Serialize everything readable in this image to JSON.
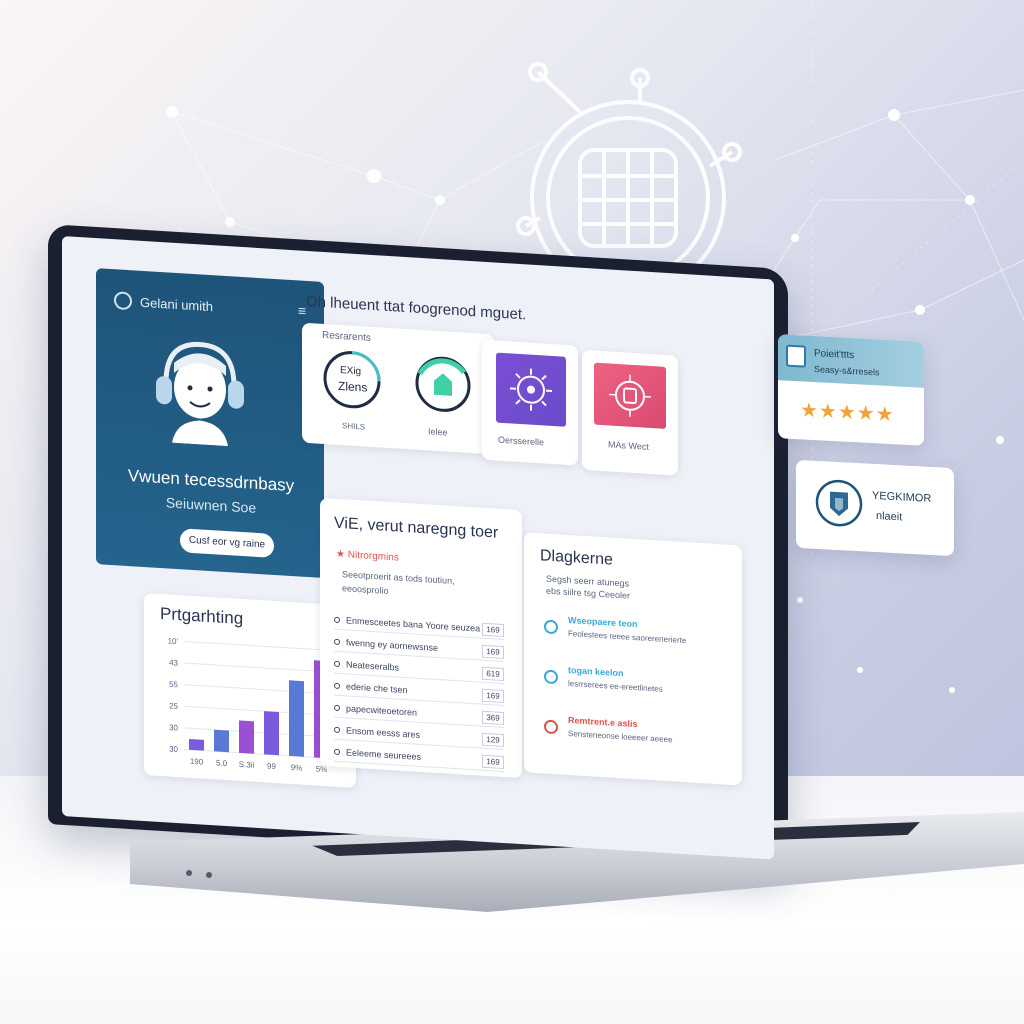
{
  "sidebar": {
    "brand": "Gelani umith",
    "menu_icon": "menu-icon",
    "name": "Vwuen tecessdrnbasy",
    "subtitle": "Seiuwnen Soe",
    "button": "Cusf eor vg raine"
  },
  "header": {
    "title": "Oh lheuent ttat foogrenod mguet."
  },
  "tiles": {
    "label": "Resrarents",
    "gauge1": {
      "value": "Zlens",
      "top": "EXig",
      "caption": "SHILS"
    },
    "gauge2": {
      "caption": "Ielee"
    },
    "tile3": {
      "caption": "Oersserelle"
    },
    "tile4": {
      "caption": "MAs Wect"
    }
  },
  "chart": {
    "title": "Prtgarhting",
    "y_ticks": [
      "10'",
      "43",
      "55",
      "25",
      "30",
      "30"
    ],
    "x_ticks": [
      "190",
      "5.0",
      "S.3ii",
      "99",
      "9%",
      "5%"
    ],
    "colors": [
      "#7a5be0",
      "#5a78d6",
      "#9b4fd3"
    ]
  },
  "chart_data": {
    "type": "bar",
    "categories": [
      "190",
      "5.0",
      "S.3ii",
      "99",
      "9%",
      "5%"
    ],
    "values": [
      1,
      2,
      3,
      4,
      7,
      9
    ],
    "title": "Prtgarhting",
    "xlabel": "",
    "ylabel": "",
    "ylim": [
      0,
      10
    ]
  },
  "list_panel": {
    "title": "ViE, verut naregng toer",
    "alert": "Nitrorgmins",
    "sub1": "Seeotproerit as tods toutiun,",
    "sub2": "eeoosprolio",
    "rows": [
      {
        "label": "Enmesceetes bana Yoore seuzea",
        "value": "169"
      },
      {
        "label": "fwenng ey aornewsnse",
        "value": "169"
      },
      {
        "label": "Neateseralbs",
        "value": "619"
      },
      {
        "label": "ederie che tsen",
        "value": "169"
      },
      {
        "label": "papecwiteoetoren",
        "value": "369"
      },
      {
        "label": "Ensom eesss ares",
        "value": "129"
      },
      {
        "label": "Eeleeme seureees",
        "value": "169"
      }
    ]
  },
  "feed_panel": {
    "title": "Dlagkerne",
    "sub1": "Segsh seerr atunegs",
    "sub2": "ebs siilre tsg Ceeoler",
    "items": [
      {
        "title": "Wseopaere teon",
        "text": "Feolestees reeee saorerenerierte",
        "color": "#3aa8d8"
      },
      {
        "title": "togan keelon",
        "text": "lesrrserees ee-ereetlinetes",
        "color": "#3aa8d8"
      },
      {
        "title": "Remtrent.e aslis",
        "text": "Sensteneonse loeeeer aeeee",
        "color": "#e0524f"
      }
    ]
  },
  "float1": {
    "title": "Poieit'ttts",
    "sub": "Seasy-s&rresels",
    "stars": "★★★★★",
    "star_color": "#f2a33a"
  },
  "float2": {
    "title": "YEGKIMOR",
    "sub": "nlaeit"
  }
}
